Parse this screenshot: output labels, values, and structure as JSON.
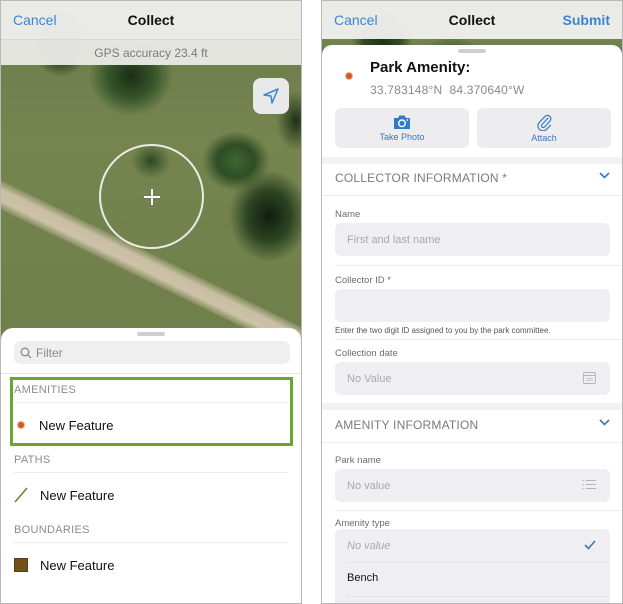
{
  "left_screen": {
    "navbar": {
      "cancel_label": "Cancel",
      "title": "Collect"
    },
    "gps_accuracy": "GPS accuracy 23.4 ft",
    "map": {
      "locate_icon": "location-arrow-icon",
      "crosshair_icon": "crosshair-icon"
    },
    "filter": {
      "placeholder": "Filter",
      "icon": "search-icon"
    },
    "groups": [
      {
        "heading": "AMENITIES",
        "item_label": "New Feature",
        "symbol": "point",
        "color": "#d25a26",
        "highlighted": true
      },
      {
        "heading": "PATHS",
        "item_label": "New Feature",
        "symbol": "line",
        "color": "#8a6a3e"
      },
      {
        "heading": "BOUNDARIES",
        "item_label": "New Feature",
        "symbol": "polygon",
        "color": "#74501c"
      }
    ],
    "highlight_color": "#6aa534"
  },
  "right_screen": {
    "navbar": {
      "cancel_label": "Cancel",
      "title": "Collect",
      "submit_label": "Submit"
    },
    "feature": {
      "title": "Park Amenity:",
      "latitude": "33.783148°N",
      "longitude": "84.370640°W"
    },
    "actions": [
      {
        "label": "Take Photo",
        "icon": "camera-icon"
      },
      {
        "label": "Attach",
        "icon": "paperclip-icon"
      }
    ],
    "sections": {
      "collector": {
        "heading": "COLLECTOR INFORMATION *",
        "fields": {
          "name": {
            "label": "Name",
            "placeholder": "First and last name",
            "value": ""
          },
          "collector_id": {
            "label": "Collector ID *",
            "value": "",
            "help": "Enter the two digit ID assigned to you by the park committee."
          },
          "collection_date": {
            "label": "Collection date",
            "value": "No Value",
            "icon": "calendar-icon"
          }
        }
      },
      "amenity": {
        "heading": "AMENITY INFORMATION",
        "fields": {
          "park_name": {
            "label": "Park name",
            "value": "No value",
            "icon": "list-icon"
          },
          "amenity_type": {
            "label": "Amenity type",
            "options": [
              {
                "label": "No value",
                "selected": true
              },
              {
                "label": "Bench",
                "selected": false
              }
            ]
          }
        }
      }
    },
    "accent_color": "#3a86d0"
  }
}
